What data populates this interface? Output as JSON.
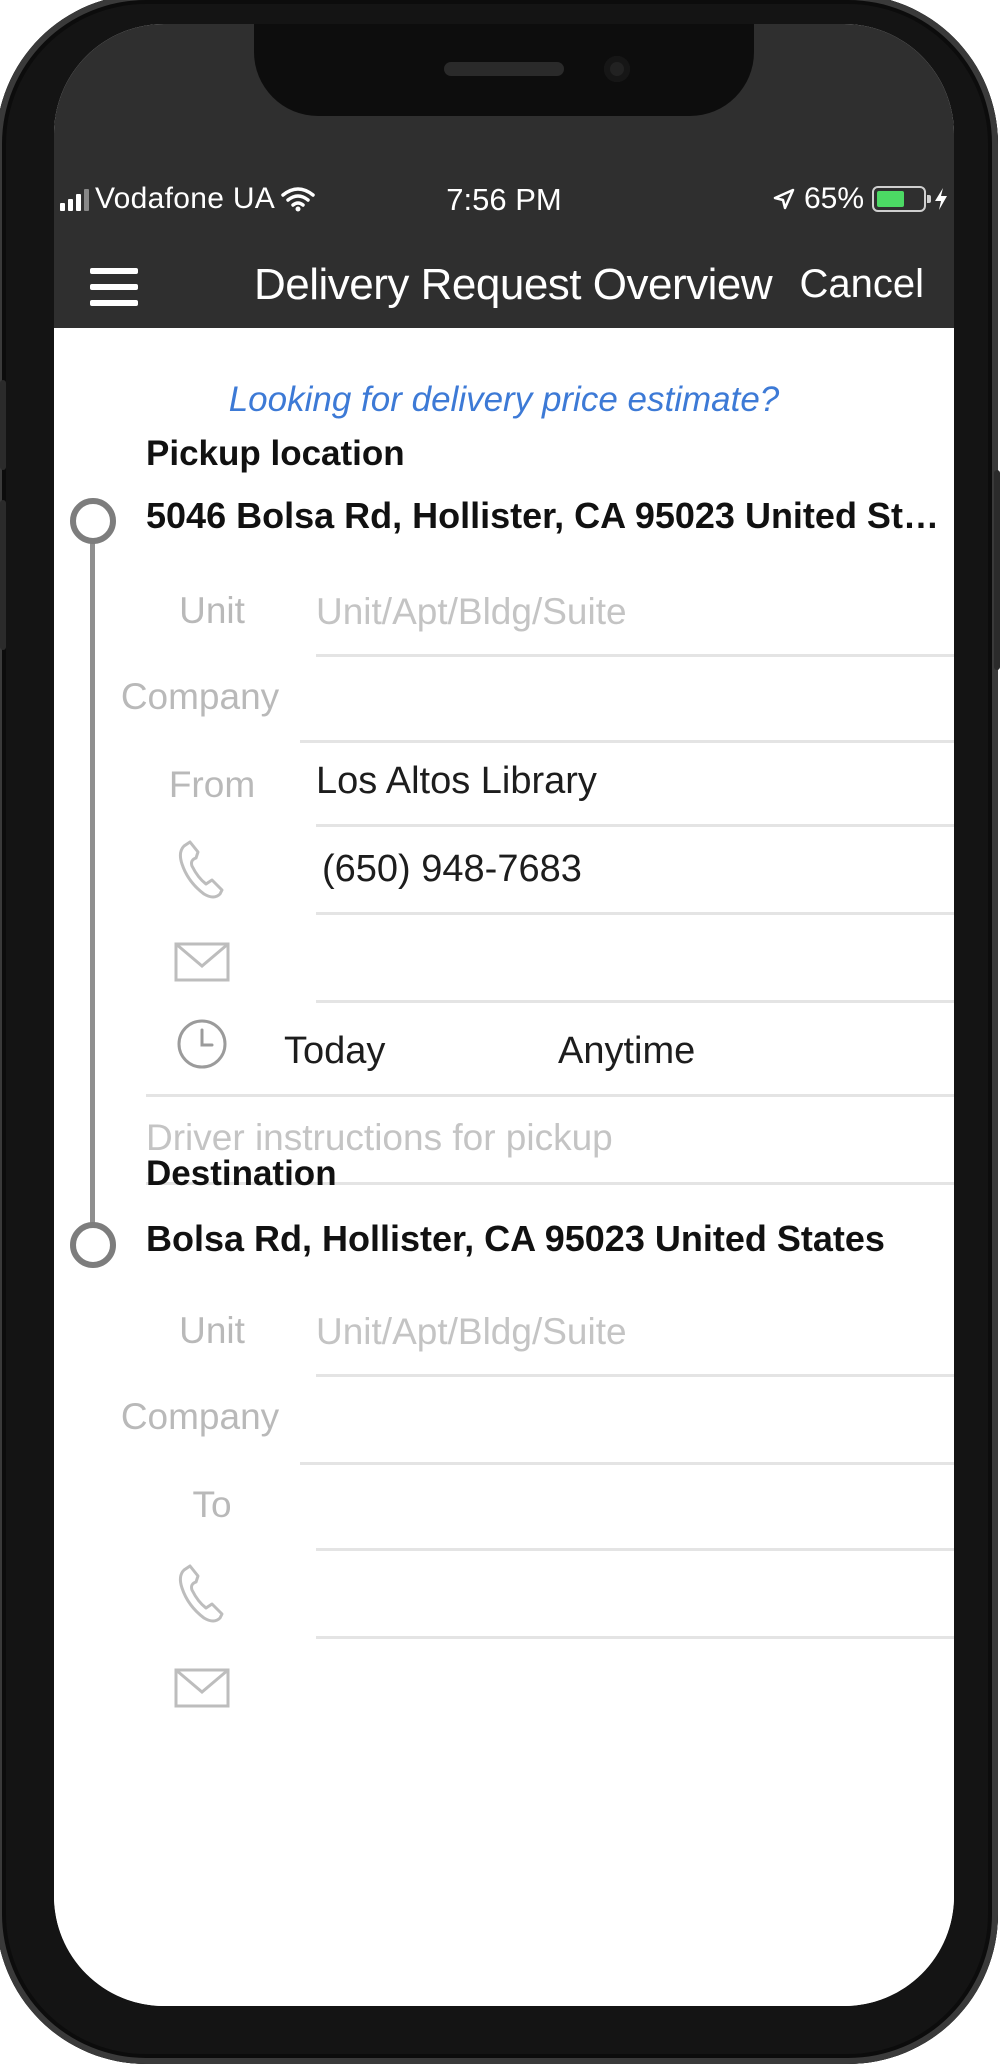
{
  "status_bar": {
    "carrier": "Vodafone UA",
    "time": "7:56 PM",
    "battery": "65%",
    "battery_level": 0.65
  },
  "nav": {
    "title": "Delivery Request Overview",
    "cancel_label": "Cancel",
    "menu_icon": "hamburger-menu-icon"
  },
  "estimate_link": "Looking for delivery price estimate?",
  "pickup": {
    "title": "Pickup location",
    "address": "5046 Bolsa Rd, Hollister, CA 95023 United States",
    "unit_label": "Unit",
    "unit_placeholder": "Unit/Apt/Bldg/Suite",
    "unit_value": "",
    "company_label": "Company",
    "company_value": "",
    "from_label": "From",
    "from_value": "Los Altos Library",
    "phone_value": "(650) 948-7683",
    "email_value": "",
    "date_value": "Today",
    "time_value": "Anytime",
    "instructions_placeholder": "Driver instructions for pickup",
    "instructions_value": ""
  },
  "destination": {
    "title": "Destination",
    "address": "Bolsa Rd, Hollister, CA 95023 United States",
    "unit_label": "Unit",
    "unit_placeholder": "Unit/Apt/Bldg/Suite",
    "unit_value": "",
    "company_label": "Company",
    "company_value": "",
    "to_label": "To",
    "to_value": "",
    "phone_value": "",
    "email_value": ""
  },
  "colors": {
    "header_bg": "#2f2f2f",
    "link": "#3d7ad6",
    "battery": "#4cd964",
    "placeholder": "#c4c4c4"
  },
  "icons": [
    "phone-icon",
    "mail-icon",
    "clock-icon",
    "wifi-icon",
    "location-arrow-icon",
    "charging-bolt-icon"
  ]
}
